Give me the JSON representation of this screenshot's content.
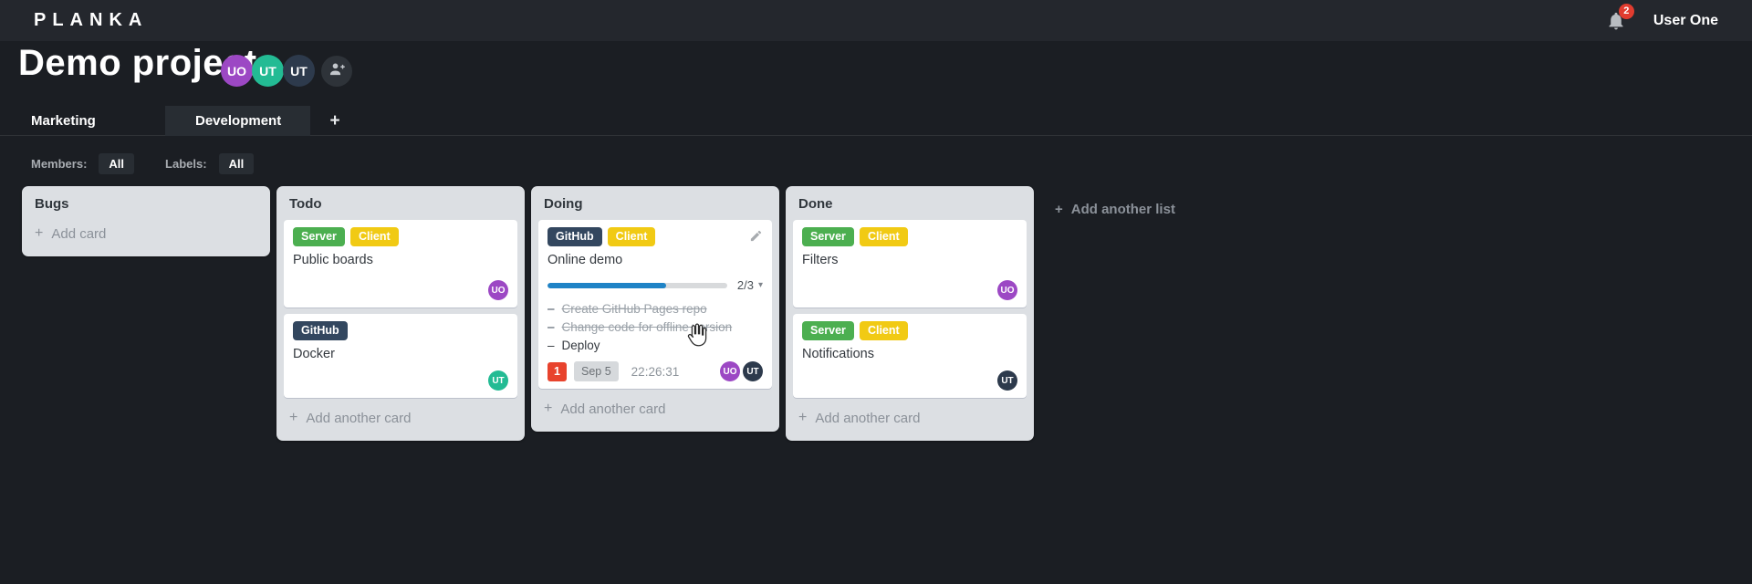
{
  "icons": {
    "plus": "+",
    "caret_down": "▾",
    "task_dash": "–"
  },
  "colors": {
    "topbar_bg": "#24272d",
    "board_bg": "#1b1e23",
    "list_bg": "#dcdfe3",
    "accent_blue": "#1f83c6",
    "danger_red": "#e8432d",
    "label_green": "#4caf50",
    "label_yellow": "#f1ca14",
    "label_navy": "#33475f",
    "avatar_purple": "#9c48c4",
    "avatar_teal": "#23bb94",
    "avatar_navy": "#2d3a4c"
  },
  "header": {
    "logo": "PLANKA",
    "notifications_count": "2",
    "user_name": "User One"
  },
  "project": {
    "title": "Demo project",
    "members": [
      {
        "initials": "UO",
        "color": "#9c48c4"
      },
      {
        "initials": "UT",
        "color": "#23bb94"
      },
      {
        "initials": "UT",
        "color": "#2d3a4c"
      }
    ]
  },
  "tabs": {
    "items": [
      {
        "label": "Marketing",
        "active": false
      },
      {
        "label": "Development",
        "active": true
      }
    ]
  },
  "filters": {
    "members_label": "Members:",
    "members_value": "All",
    "labels_label": "Labels:",
    "labels_value": "All"
  },
  "board": {
    "add_list_label": "Add another list",
    "lists": [
      {
        "name": "Bugs",
        "add_card_label": "Add card",
        "cards": []
      },
      {
        "name": "Todo",
        "add_card_label": "Add another card",
        "cards": [
          {
            "name": "Public boards",
            "labels": [
              {
                "text": "Server",
                "color": "#4caf50"
              },
              {
                "text": "Client",
                "color": "#f1ca14"
              }
            ],
            "member": {
              "initials": "UO",
              "color": "#9c48c4"
            }
          },
          {
            "name": "Docker",
            "labels": [
              {
                "text": "GitHub",
                "color": "#33475f"
              }
            ],
            "member": {
              "initials": "UT",
              "color": "#23bb94"
            }
          }
        ]
      },
      {
        "name": "Doing",
        "add_card_label": "Add another card",
        "cards": [
          {
            "name": "Online demo",
            "labels": [
              {
                "text": "GitHub",
                "color": "#33475f"
              },
              {
                "text": "Client",
                "color": "#f1ca14"
              }
            ],
            "progress": {
              "percent": 66,
              "fraction": "2/3"
            },
            "tasks": [
              {
                "text": "Create GitHub Pages repo",
                "done": true
              },
              {
                "text": "Change code for offline version",
                "done": true
              },
              {
                "text": "Deploy",
                "done": false
              }
            ],
            "badges": {
              "due_count": "1",
              "due_date": "Sep 5",
              "timer": "22:26:31"
            },
            "members": [
              {
                "initials": "UO",
                "color": "#9c48c4"
              },
              {
                "initials": "UT",
                "color": "#2d3a4c"
              }
            ]
          }
        ]
      },
      {
        "name": "Done",
        "add_card_label": "Add another card",
        "cards": [
          {
            "name": "Filters",
            "labels": [
              {
                "text": "Server",
                "color": "#4caf50"
              },
              {
                "text": "Client",
                "color": "#f1ca14"
              }
            ],
            "member": {
              "initials": "UO",
              "color": "#9c48c4"
            }
          },
          {
            "name": "Notifications",
            "labels": [
              {
                "text": "Server",
                "color": "#4caf50"
              },
              {
                "text": "Client",
                "color": "#f1ca14"
              }
            ],
            "member": {
              "initials": "UT",
              "color": "#2d3a4c"
            }
          }
        ]
      }
    ]
  }
}
